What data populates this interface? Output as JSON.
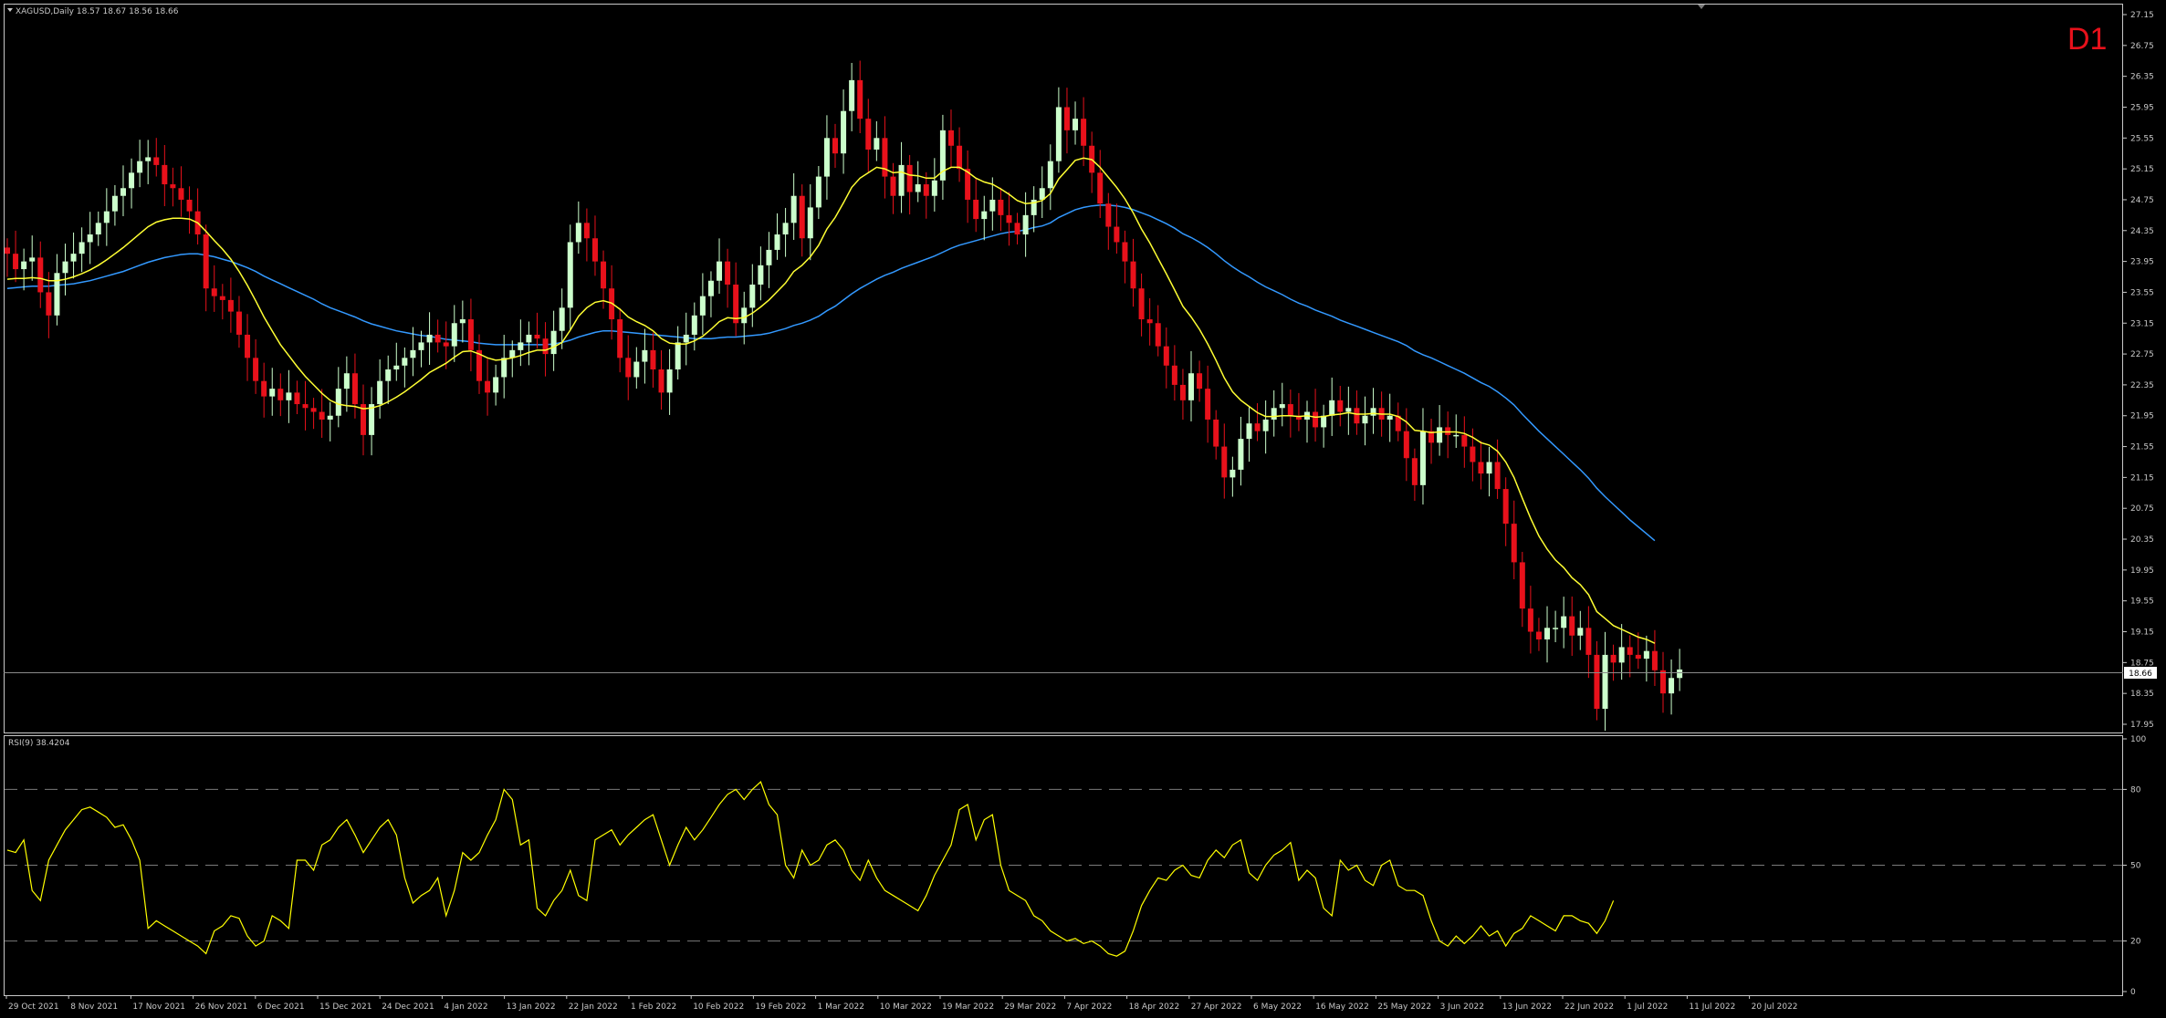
{
  "window": {
    "symbol_info": "XAGUSD,Daily  18.57 18.67 18.56 18.66",
    "timeframe_badge": "D1",
    "rsi_header": "RSI(9) 38.4204",
    "current_price_label": "18.66"
  },
  "colors": {
    "background": "#000000",
    "frame": "#c8c8c8",
    "bull_candle": "#ccffcc",
    "bear_candle": "#e8111b",
    "ma_fast": "#ffff33",
    "ma_slow": "#3399ff",
    "rsi_line": "#ffff00",
    "badge": "#e8111b"
  },
  "chart_data": [
    {
      "type": "candlestick",
      "instrument": "XAGUSD",
      "timeframe": "Daily",
      "y_ticks": [
        "27.15",
        "26.75",
        "26.35",
        "25.95",
        "25.55",
        "25.15",
        "24.75",
        "24.35",
        "23.95",
        "23.55",
        "23.15",
        "22.75",
        "22.35",
        "21.95",
        "21.55",
        "21.15",
        "20.75",
        "20.35",
        "19.95",
        "19.55",
        "19.15",
        "18.75",
        "18.35",
        "17.95"
      ],
      "ylim": [
        17.95,
        27.15
      ],
      "x_ticks": [
        "29 Oct 2021",
        "8 Nov 2021",
        "17 Nov 2021",
        "26 Nov 2021",
        "6 Dec 2021",
        "15 Dec 2021",
        "24 Dec 2021",
        "4 Jan 2022",
        "13 Jan 2022",
        "22 Jan 2022",
        "1 Feb 2022",
        "10 Feb 2022",
        "19 Feb 2022",
        "1 Mar 2022",
        "10 Mar 2022",
        "19 Mar 2022",
        "29 Mar 2022",
        "7 Apr 2022",
        "18 Apr 2022",
        "27 Apr 2022",
        "6 May 2022",
        "16 May 2022",
        "25 May 2022",
        "3 Jun 2022",
        "13 Jun 2022",
        "22 Jun 2022",
        "1 Jul 2022",
        "11 Jul 2022",
        "20 Jul 2022"
      ],
      "last_price": 18.66,
      "series": [
        {
          "name": "Close",
          "values": [
            24.05,
            23.85,
            23.95,
            24.0,
            23.55,
            23.25,
            23.8,
            23.95,
            24.05,
            24.2,
            24.3,
            24.45,
            24.6,
            24.8,
            24.9,
            25.1,
            25.25,
            25.3,
            25.2,
            24.95,
            24.9,
            24.75,
            24.6,
            24.3,
            23.6,
            23.5,
            23.45,
            23.3,
            23.0,
            22.7,
            22.4,
            22.2,
            22.3,
            22.15,
            22.25,
            22.1,
            22.05,
            22.0,
            21.9,
            21.95,
            22.3,
            22.5,
            22.1,
            21.7,
            22.1,
            22.4,
            22.55,
            22.6,
            22.7,
            22.8,
            22.9,
            23.0,
            22.9,
            22.85,
            23.15,
            23.2,
            22.8,
            22.4,
            22.25,
            22.45,
            22.7,
            22.8,
            22.9,
            23.0,
            22.95,
            22.75,
            23.05,
            23.35,
            24.2,
            24.45,
            24.25,
            23.95,
            23.6,
            23.2,
            22.7,
            22.45,
            22.65,
            22.8,
            22.55,
            22.25,
            22.55,
            22.9,
            23.0,
            23.25,
            23.5,
            23.7,
            23.95,
            23.65,
            23.15,
            23.35,
            23.65,
            23.9,
            24.1,
            24.3,
            24.45,
            24.8,
            24.25,
            24.65,
            25.05,
            25.55,
            25.35,
            25.9,
            26.3,
            25.8,
            25.4,
            25.55,
            25.05,
            24.8,
            25.2,
            24.85,
            24.95,
            24.8,
            25.0,
            25.65,
            25.45,
            25.15,
            24.75,
            24.5,
            24.6,
            24.75,
            24.55,
            24.45,
            24.3,
            24.55,
            24.75,
            24.9,
            25.25,
            25.95,
            25.65,
            25.8,
            25.45,
            25.1,
            24.7,
            24.4,
            24.2,
            23.95,
            23.6,
            23.2,
            23.15,
            22.85,
            22.6,
            22.35,
            22.15,
            22.5,
            22.3,
            21.9,
            21.55,
            21.15,
            21.25,
            21.65,
            21.85,
            21.75,
            21.9,
            22.05,
            22.1,
            21.95,
            21.9,
            22.0,
            21.8,
            21.95,
            22.15,
            22.0,
            22.05,
            21.85,
            21.95,
            22.05,
            21.9,
            21.95,
            21.75,
            21.4,
            21.05,
            21.75,
            21.6,
            21.8,
            21.7,
            21.7,
            21.55,
            21.35,
            21.2,
            21.35,
            21.0,
            20.55,
            20.05,
            19.45,
            19.15,
            19.05,
            19.2,
            19.2,
            19.35,
            19.1,
            19.2,
            18.85,
            18.15,
            18.85,
            18.75,
            18.95,
            18.85,
            18.8,
            18.9,
            18.65,
            18.35,
            18.55,
            18.66
          ]
        },
        {
          "name": "MA fast",
          "values": [
            23.72,
            23.73,
            23.73,
            23.74,
            23.73,
            23.7,
            23.7,
            23.72,
            23.75,
            23.79,
            23.84,
            23.9,
            23.97,
            24.05,
            24.13,
            24.22,
            24.31,
            24.4,
            24.46,
            24.49,
            24.51,
            24.51,
            24.5,
            24.45,
            24.34,
            24.22,
            24.11,
            23.98,
            23.82,
            23.64,
            23.44,
            23.23,
            23.05,
            22.87,
            22.73,
            22.59,
            22.46,
            22.35,
            22.24,
            22.15,
            22.1,
            22.08,
            22.07,
            22.04,
            22.05,
            22.08,
            22.13,
            22.19,
            22.26,
            22.34,
            22.42,
            22.51,
            22.57,
            22.63,
            22.71,
            22.78,
            22.79,
            22.75,
            22.7,
            22.67,
            22.68,
            22.7,
            22.73,
            22.77,
            22.8,
            22.8,
            22.84,
            22.9,
            23.06,
            23.24,
            23.35,
            23.42,
            23.44,
            23.41,
            23.33,
            23.23,
            23.17,
            23.12,
            23.05,
            22.95,
            22.89,
            22.88,
            22.88,
            22.92,
            22.98,
            23.07,
            23.17,
            23.22,
            23.21,
            23.22,
            23.28,
            23.36,
            23.45,
            23.56,
            23.67,
            23.82,
            23.9,
            24.01,
            24.16,
            24.37,
            24.52,
            24.71,
            24.91,
            25.03,
            25.1,
            25.17,
            25.15,
            25.1,
            25.11,
            25.07,
            25.06,
            25.03,
            25.03,
            25.12,
            25.17,
            25.17,
            25.11,
            25.03,
            24.98,
            24.95,
            24.89,
            24.82,
            24.74,
            24.7,
            24.71,
            24.74,
            24.83,
            25.02,
            25.14,
            25.26,
            25.29,
            25.27,
            25.17,
            25.04,
            24.91,
            24.76,
            24.58,
            24.37,
            24.19,
            23.99,
            23.79,
            23.58,
            23.37,
            23.23,
            23.07,
            22.88,
            22.67,
            22.44,
            22.26,
            22.15,
            22.07,
            21.99,
            21.94,
            21.94,
            21.95,
            21.95,
            21.94,
            21.95,
            21.93,
            21.94,
            21.96,
            21.97,
            21.99,
            21.97,
            21.97,
            21.98,
            21.97,
            21.97,
            21.94,
            21.87,
            21.76,
            21.75,
            21.73,
            21.74,
            21.74,
            21.74,
            21.72,
            21.67,
            21.6,
            21.57,
            21.49,
            21.35,
            21.15,
            20.88,
            20.62,
            20.39,
            20.22,
            20.08,
            19.98,
            19.85,
            19.76,
            19.63,
            19.41,
            19.32,
            19.23,
            19.18,
            19.13,
            19.08,
            19.05,
            19.0
          ]
        },
        {
          "name": "MA slow",
          "values": [
            23.6,
            23.61,
            23.62,
            23.63,
            23.63,
            23.63,
            23.64,
            23.65,
            23.66,
            23.68,
            23.7,
            23.73,
            23.76,
            23.79,
            23.82,
            23.86,
            23.9,
            23.94,
            23.97,
            24.0,
            24.02,
            24.04,
            24.05,
            24.05,
            24.03,
            24.01,
            23.98,
            23.95,
            23.91,
            23.87,
            23.82,
            23.76,
            23.71,
            23.66,
            23.61,
            23.56,
            23.51,
            23.46,
            23.4,
            23.35,
            23.31,
            23.27,
            23.23,
            23.18,
            23.14,
            23.11,
            23.08,
            23.05,
            23.03,
            23.01,
            22.99,
            22.98,
            22.96,
            22.94,
            22.93,
            22.92,
            22.91,
            22.89,
            22.88,
            22.87,
            22.87,
            22.87,
            22.87,
            22.87,
            22.87,
            22.87,
            22.88,
            22.9,
            22.93,
            22.97,
            23.0,
            23.03,
            23.05,
            23.05,
            23.04,
            23.03,
            23.02,
            23.01,
            23.0,
            22.99,
            22.98,
            22.97,
            22.96,
            22.95,
            22.95,
            22.95,
            22.96,
            22.97,
            22.97,
            22.98,
            22.99,
            23.0,
            23.02,
            23.05,
            23.08,
            23.12,
            23.15,
            23.19,
            23.24,
            23.31,
            23.37,
            23.45,
            23.53,
            23.6,
            23.66,
            23.72,
            23.77,
            23.81,
            23.86,
            23.9,
            23.94,
            23.98,
            24.02,
            24.07,
            24.12,
            24.16,
            24.19,
            24.22,
            24.25,
            24.28,
            24.31,
            24.33,
            24.34,
            24.36,
            24.39,
            24.41,
            24.45,
            24.52,
            24.57,
            24.62,
            24.65,
            24.67,
            24.68,
            24.68,
            24.67,
            24.65,
            24.62,
            24.58,
            24.54,
            24.49,
            24.44,
            24.38,
            24.31,
            24.26,
            24.2,
            24.13,
            24.05,
            23.96,
            23.88,
            23.81,
            23.75,
            23.68,
            23.62,
            23.57,
            23.52,
            23.46,
            23.41,
            23.37,
            23.32,
            23.28,
            23.24,
            23.19,
            23.15,
            23.11,
            23.07,
            23.03,
            22.99,
            22.95,
            22.91,
            22.86,
            22.79,
            22.74,
            22.7,
            22.65,
            22.6,
            22.55,
            22.5,
            22.44,
            22.38,
            22.33,
            22.26,
            22.18,
            22.09,
            21.97,
            21.86,
            21.75,
            21.65,
            21.55,
            21.45,
            21.35,
            21.25,
            21.14,
            21.01,
            20.9,
            20.8,
            20.7,
            20.6,
            20.51,
            20.42,
            20.33
          ]
        }
      ]
    },
    {
      "type": "line",
      "indicator": "RSI(9)",
      "ylim": [
        0,
        100
      ],
      "y_ticks": [
        "100",
        "80",
        "50",
        "20",
        "0"
      ],
      "levels": [
        80,
        50,
        20
      ],
      "series": [
        {
          "name": "RSI(9)",
          "values": [
            56,
            55,
            60,
            40,
            36,
            52,
            58,
            64,
            68,
            72,
            73,
            71,
            69,
            65,
            66,
            60,
            52,
            25,
            28,
            26,
            24,
            22,
            20,
            18,
            15,
            24,
            26,
            30,
            29,
            22,
            18,
            20,
            30,
            28,
            25,
            52,
            52,
            48,
            58,
            60,
            65,
            68,
            62,
            55,
            60,
            65,
            68,
            62,
            45,
            35,
            38,
            40,
            45,
            30,
            40,
            55,
            52,
            55,
            62,
            68,
            80,
            76,
            58,
            60,
            33,
            30,
            36,
            40,
            48,
            38,
            36,
            60,
            62,
            64,
            58,
            62,
            65,
            68,
            70,
            60,
            50,
            58,
            65,
            60,
            64,
            69,
            74,
            78,
            80,
            76,
            80,
            83,
            74,
            70,
            50,
            45,
            56,
            50,
            52,
            58,
            60,
            56,
            48,
            44,
            52,
            45,
            40,
            38,
            36,
            34,
            32,
            38,
            46,
            52,
            58,
            72,
            74,
            60,
            68,
            70,
            50,
            40,
            38,
            36,
            30,
            28,
            24,
            22,
            20,
            21,
            19,
            20,
            18,
            15,
            14,
            16,
            24,
            34,
            40,
            45,
            44,
            48,
            50,
            46,
            45,
            52,
            56,
            53,
            58,
            60,
            47,
            44,
            50,
            54,
            56,
            59,
            44,
            48,
            45,
            33,
            30,
            52,
            48,
            50,
            44,
            42,
            50,
            52,
            42,
            40,
            40,
            38,
            28,
            20,
            18,
            22,
            19,
            22,
            26,
            22,
            24,
            18,
            23,
            25,
            30,
            28,
            26,
            24,
            30,
            30,
            28,
            27,
            23,
            28,
            36
          ]
        }
      ]
    }
  ]
}
